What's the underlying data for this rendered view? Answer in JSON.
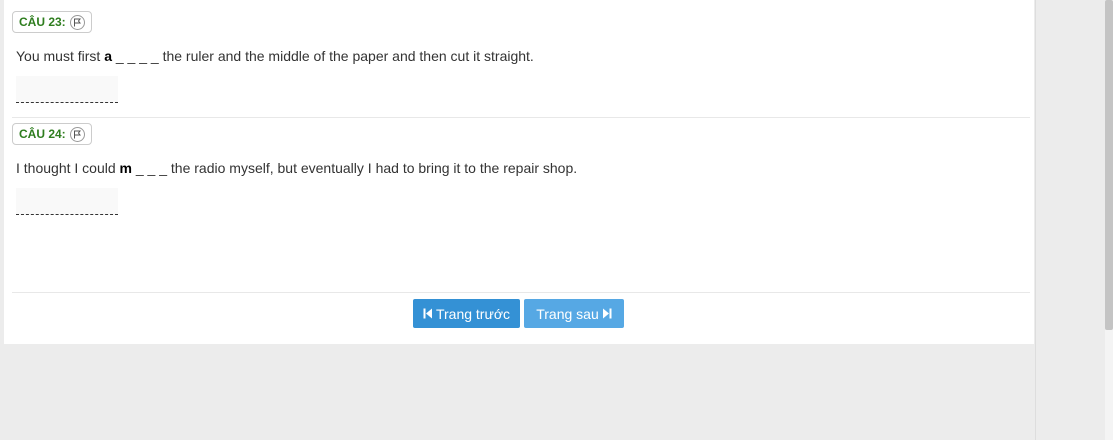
{
  "questions": [
    {
      "label": "CÂU 23:",
      "text_before": "You must first ",
      "hint_letter": "a",
      "blanks": " _ _ _ _ ",
      "text_after": "the ruler and the middle of the paper and then cut it straight.",
      "answer_value": ""
    },
    {
      "label": "CÂU 24:",
      "text_before": "I thought I could ",
      "hint_letter": "m",
      "blanks": " _ _ _ ",
      "text_after": "the radio myself, but eventually I had to bring it to the repair shop.",
      "answer_value": ""
    }
  ],
  "navigation": {
    "prev_label": "Trang trước",
    "next_label": "Trang sau"
  },
  "icons": {
    "question_flag": "flag-icon",
    "prev": "skip-previous-icon",
    "next": "skip-next-icon"
  },
  "colors": {
    "label_green": "#2e7d1e",
    "button_primary": "#3491d5",
    "button_secondary": "#56a8e4"
  }
}
